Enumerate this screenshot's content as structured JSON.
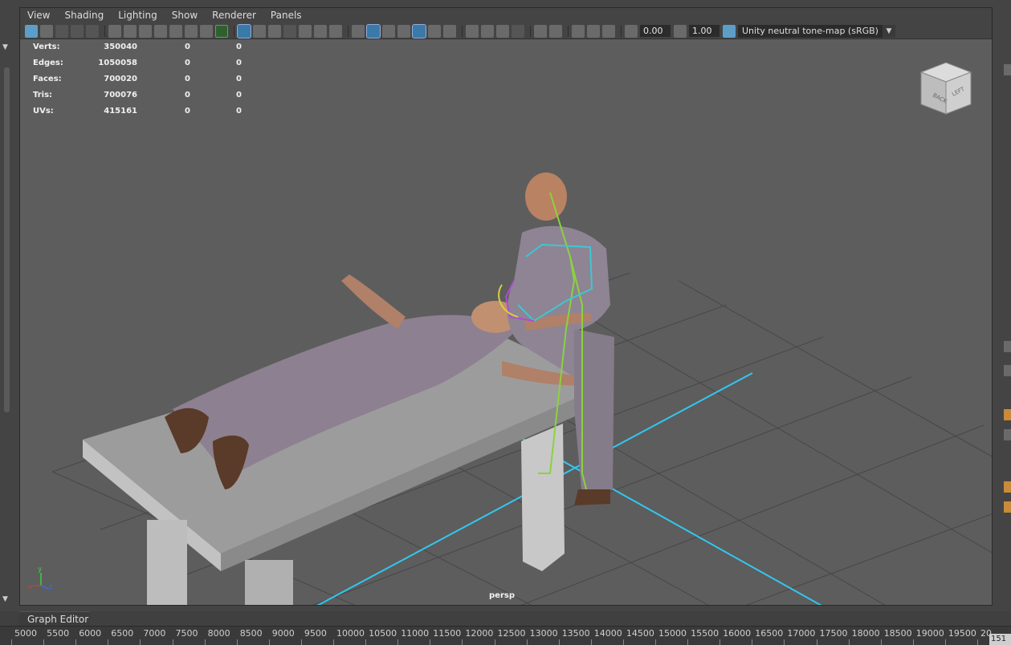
{
  "menubar": [
    "View",
    "Shading",
    "Lighting",
    "Show",
    "Renderer",
    "Panels"
  ],
  "toolbar": {
    "exposure": "0.00",
    "gamma": "1.00",
    "tone_map": "Unity neutral tone-map (sRGB)"
  },
  "hud": {
    "rows": [
      {
        "label": "Verts:",
        "v1": "350040",
        "v2": "0",
        "v3": "0"
      },
      {
        "label": "Edges:",
        "v1": "1050058",
        "v2": "0",
        "v3": "0"
      },
      {
        "label": "Faces:",
        "v1": "700020",
        "v2": "0",
        "v3": "0"
      },
      {
        "label": "Tris:",
        "v1": "700076",
        "v2": "0",
        "v3": "0"
      },
      {
        "label": "UVs:",
        "v1": "415161",
        "v2": "0",
        "v3": "0"
      }
    ]
  },
  "view_cube": {
    "back": "BACK",
    "left": "LEFT"
  },
  "camera_label": "persp",
  "axis": {
    "x": "x",
    "y": "y",
    "z": "z"
  },
  "graph_editor_tab": "Graph Editor",
  "timeline": {
    "ticks": [
      "5000",
      "5500",
      "6000",
      "6500",
      "7000",
      "7500",
      "8000",
      "8500",
      "9000",
      "9500",
      "10000",
      "10500",
      "11000",
      "11500",
      "12000",
      "12500",
      "13000",
      "13500",
      "14000",
      "14500",
      "15000",
      "15500",
      "16000",
      "16500",
      "17000",
      "17500",
      "18000",
      "18500",
      "19000",
      "19500",
      "20"
    ],
    "current_frame": "151"
  },
  "colors": {
    "viewport_bg": "#5d5d5d",
    "grid_axis": "#31c8f0",
    "skeleton_green": "#8cd23c",
    "skeleton_cyan": "#3cc8d2"
  }
}
